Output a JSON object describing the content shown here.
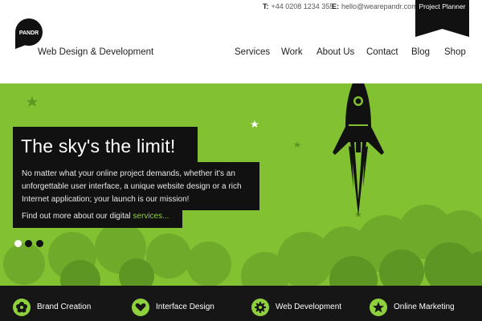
{
  "header": {
    "phone_label": "T:",
    "phone": "+44 0208 1234 355",
    "email_label": "E:",
    "email": "hello@wearepandr.com",
    "project_planner": "Project Planner",
    "logo_text": "PANDR",
    "tagline": "Web Design & Development"
  },
  "nav": {
    "items": [
      "Services",
      "Work",
      "About Us",
      "Contact",
      "Blog",
      "Shop"
    ]
  },
  "hero": {
    "headline": "The sky's the limit!",
    "body": "No matter what your online project demands, whether it's an unforgettable user interface, a unique website design or a rich Internet application; your launch is our mission!",
    "cta_prefix": "Find out more about our digital ",
    "cta_link": "services...",
    "slides": {
      "count": 3,
      "active": 1
    }
  },
  "services": [
    {
      "label": "Brand Creation",
      "icon": "flower-icon"
    },
    {
      "label": "Interface Design",
      "icon": "heart-icon"
    },
    {
      "label": "Web Development",
      "icon": "gear-icon"
    },
    {
      "label": "Online Marketing",
      "icon": "star-icon"
    }
  ],
  "colors": {
    "accent_green": "#82c131",
    "dark": "#111111"
  }
}
